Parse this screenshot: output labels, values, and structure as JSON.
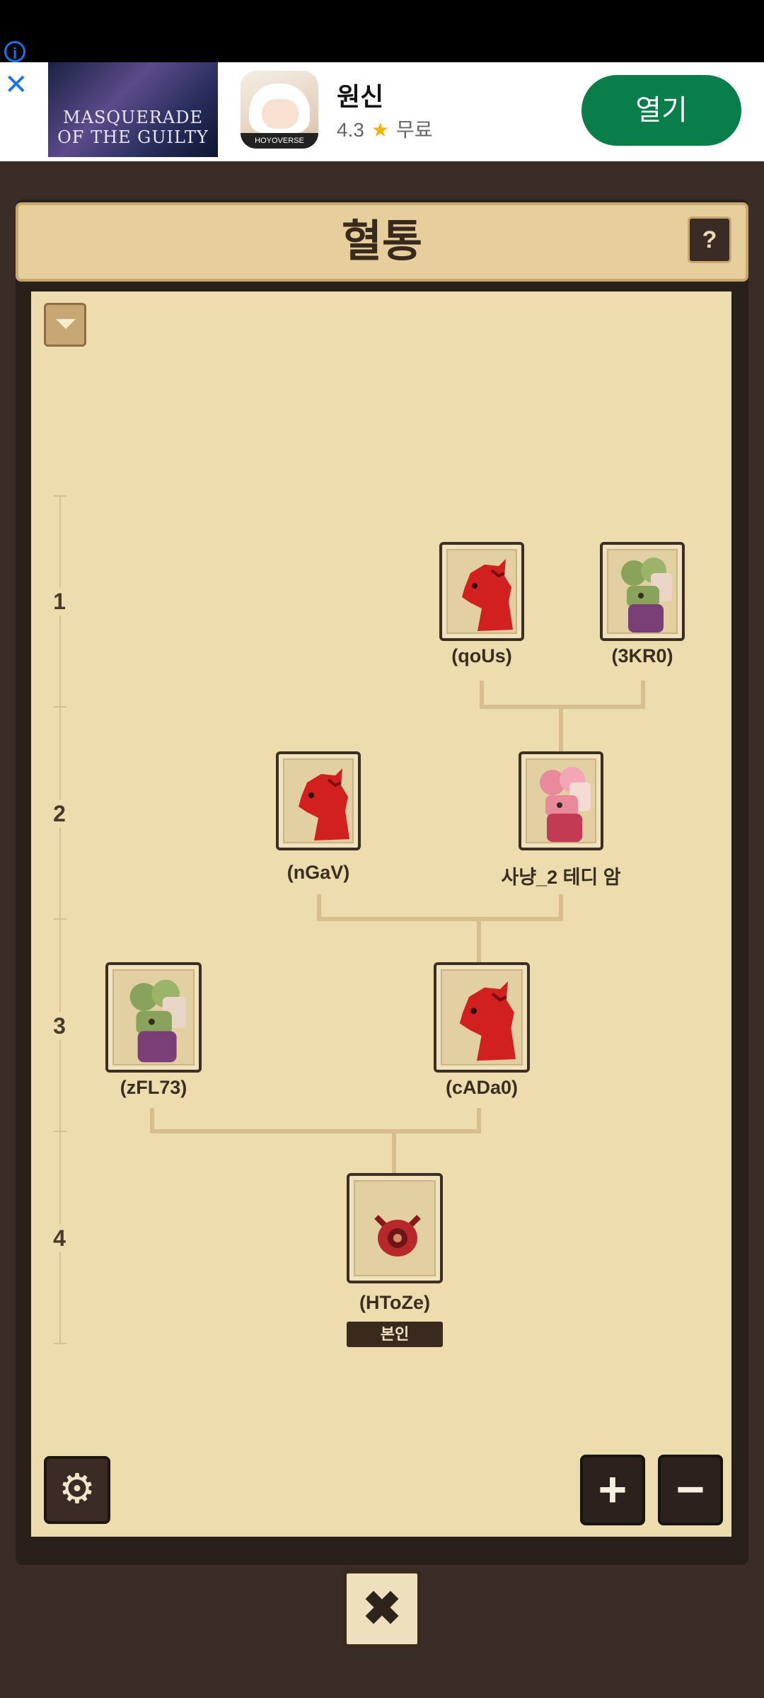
{
  "ad": {
    "banner_text": "MASQUERADE OF THE GUILTY",
    "app_icon_label": "HOYOVERSE",
    "app_name": "원신",
    "rating": "4.3",
    "price": "무료",
    "open_label": "열기",
    "info_icon": "info-icon",
    "close_icon": "close-icon"
  },
  "header": {
    "title": "혈통",
    "help_label": "?"
  },
  "generations": [
    "1",
    "2",
    "3",
    "4"
  ],
  "nodes": {
    "qoUs": {
      "name": "(qoUs)",
      "creature": "red-dragon"
    },
    "k3r0": {
      "name": "(3KR0)",
      "creature": "green-plant-creature"
    },
    "nGaV": {
      "name": "(nGaV)",
      "creature": "red-dragon"
    },
    "teddy": {
      "name": "사냥_2 테디 암",
      "creature": "pink-plant-creature"
    },
    "zFL73": {
      "name": "(zFL73)",
      "creature": "green-plant-creature"
    },
    "cADa0": {
      "name": "(cADa0)",
      "creature": "red-dragon"
    },
    "HToZe": {
      "name": "(HToZe)",
      "creature": "dragon-egg",
      "badge": "본인"
    }
  },
  "controls": {
    "settings_icon": "gear-icon",
    "zoom_in": "+",
    "zoom_out": "−",
    "close": "✖"
  },
  "colors": {
    "board": "#ecdcae",
    "frame": "#2a201b",
    "ad_button": "#0a7e4a",
    "dragon_red": "#d21f1f"
  }
}
